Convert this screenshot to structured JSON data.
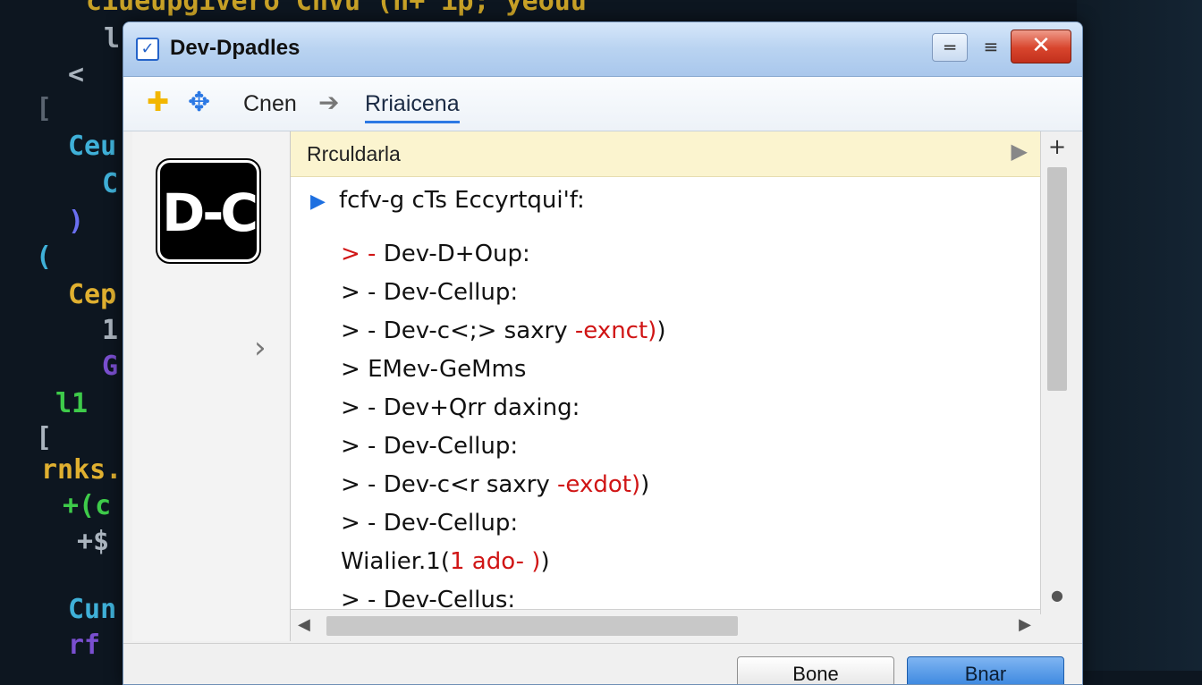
{
  "background_code": {
    "lines": [
      {
        "text": "ciueupgivero Cnvu (n+ ip; yeouu",
        "color": "#c9a227"
      },
      {
        "text": "l",
        "color": "#aab4be"
      },
      {
        "text": "<",
        "color": "#aab4be"
      },
      {
        "text": "[",
        "color": "#5a6470"
      },
      {
        "text": "Ceu",
        "color": "#3fb0d8"
      },
      {
        "text": "C",
        "color": "#3fb0d8"
      },
      {
        "text": ")",
        "color": "#6a6ff0"
      },
      {
        "text": "(",
        "color": "#3fb0d8"
      },
      {
        "text": "Cep",
        "color": "#e0b030"
      },
      {
        "text": "1",
        "color": "#aab4be"
      },
      {
        "text": "G",
        "color": "#7a4fd0"
      },
      {
        "text": "l1",
        "color": "#3ecb4a"
      },
      {
        "text": "[",
        "color": "#aab4be"
      },
      {
        "text": "rnks.",
        "color": "#e0b030"
      },
      {
        "text": "+(c",
        "color": "#3ecb4a"
      },
      {
        "text": "+$",
        "color": "#aab4be"
      },
      {
        "text": "Cun",
        "color": "#3fb0d8"
      },
      {
        "text": "rf",
        "color": "#7a4fd0"
      }
    ]
  },
  "window": {
    "title": "Dev-Dpadles",
    "buttons": {
      "minimize": "═",
      "maximize": "≡",
      "close": "✕"
    }
  },
  "toolbar": {
    "label": "Cnen",
    "active_tab": "Rriaicena"
  },
  "sidebar": {
    "logo_text": "D-C"
  },
  "pane": {
    "header": "Rrculdarla",
    "root": "fcfv-g cTs Eccyrtqui'f:",
    "items": [
      {
        "marker": "> -",
        "text": "Dev-D+Oup:",
        "suffix": "",
        "marker_red": true
      },
      {
        "marker": "> -",
        "text": "Dev-Cellup:",
        "suffix": "",
        "marker_red": false
      },
      {
        "marker": "> -",
        "text": "Dev-c<;> saxry ",
        "suffix": "-exnct)",
        "tail": ")",
        "marker_red": false
      },
      {
        "marker": ">",
        "text": "EMev-GeMms",
        "suffix": "",
        "marker_red": false
      },
      {
        "marker": "> -",
        "text": "Dev+Qrr daxing:",
        "suffix": "",
        "marker_red": false
      },
      {
        "marker": "> -",
        "text": "Dev-Cellup:",
        "suffix": "",
        "marker_red": false
      },
      {
        "marker": "> -",
        "text": "Dev-c<r saxry ",
        "suffix": "-exdot)",
        "tail": ")",
        "marker_red": false
      },
      {
        "marker": "> -",
        "text": "Dev-Cellup:",
        "suffix": "",
        "marker_red": false
      },
      {
        "marker": "",
        "text": "Wialier.1(",
        "suffix": "1 ado- )",
        "tail": ")",
        "marker_red": false
      },
      {
        "marker": "> -",
        "text": "Dev-Cellus:",
        "suffix": "",
        "marker_red": false
      }
    ]
  },
  "footer": {
    "cancel_label": "Bone",
    "ok_label": "Bnar"
  },
  "colors": {
    "accent": "#2b78e4",
    "error_red": "#d01515",
    "header_bg": "#fbf4cf",
    "close_red": "#d8452d"
  }
}
